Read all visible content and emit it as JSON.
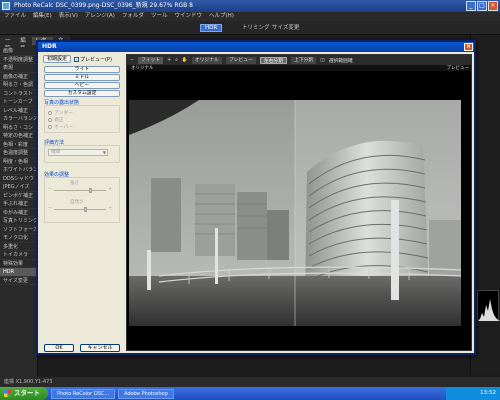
{
  "window": {
    "title": "Photo ReCalc DSC_0399.png-DSC_0396_新規 29.67% RGB 8",
    "minimize": "_",
    "maximize": "□",
    "close": "×"
  },
  "menu": [
    "ファイル",
    "編集(E)",
    "表示(V)",
    "アレンジ(A)",
    "フォルダ",
    "ツール",
    "ウインドウ",
    "ヘルプ(H)"
  ],
  "toolbar": {
    "items": [
      "一覧",
      "編集",
      "レタッチ",
      "文字"
    ],
    "hdr_label": "HDR",
    "trimming": "トリミング",
    "resize": "サイズ変更"
  },
  "left_panel": {
    "items": [
      "画像",
      "不透明度調整",
      "表現",
      "画像の補正",
      "明るさ・色調",
      "コントラスト",
      "トーンカーブ",
      "レベル補正",
      "カラーバランス",
      "明るさ・コン",
      "特定の色補正",
      "色相・彩度",
      "色温度調整",
      "明度・色相",
      "ホワイトバランス",
      "DDSシャドウ",
      "JPEGノイズ",
      "ピンボケ補正",
      "手ぶれ補正",
      "ゆがみ補正",
      "写真トリミング",
      "ソフトフォーカス",
      "モノクロ化",
      "多重化",
      "トイカメラ",
      "特殊効果",
      "HDR",
      "サイズ変更"
    ],
    "selected_index": 26
  },
  "status_bar": "座標 X1,900,Y1-473",
  "taskbar": {
    "start": "スタート",
    "tasks": [
      "Photo ReColor DSC...",
      "Adobe Photoshop"
    ],
    "clock": "13:52"
  },
  "dialog": {
    "title": "HDR",
    "close_label": "×",
    "reset_label": "初期設定",
    "preview_label": "プレビュー(P)",
    "preview_checked": true,
    "presets": [
      "ライト",
      "ミドル",
      "ヘビー",
      "カスタム設定"
    ],
    "section_photo_type": "写真の露出状態",
    "radios": [
      "アンダー",
      "適正",
      "オーバー"
    ],
    "section_eval": "評価方法",
    "eval_value": "標準",
    "section_effect": "効果の調整",
    "slider1_label": "強さ",
    "slider2_label": "自然さ",
    "slider1_value": 0.7,
    "slider2_value": 0.6,
    "ok_label": "OK",
    "cancel_label": "キャンセル"
  },
  "viewer": {
    "fit_label": "フィット",
    "zoom_in": "+",
    "zoom_out": "−",
    "hand_icon": "hand-icon",
    "mode_original": "オリジナル",
    "mode_preview": "プレビュー",
    "mode_split": "左右分割",
    "mode_side": "上下分割",
    "select_area": "選択範囲確",
    "label_left": "オリジナル",
    "label_right": "プレビュー"
  },
  "colors": {
    "dialog_bg": "#ece9d8",
    "titlebar": "#0a58d6",
    "accent": "#3a6fd0"
  }
}
